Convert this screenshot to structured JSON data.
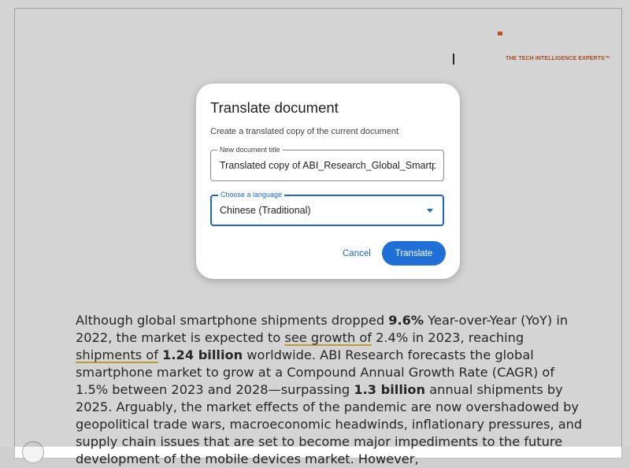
{
  "document": {
    "logo_tagline": "THE TECH INTELLIGENCE EXPERTS™",
    "body": {
      "s1": "Although global smartphone shipments dropped ",
      "b1": "9.6%",
      "s2": " Year-over-Year (YoY) in 2022, the market is expected to ",
      "u1": "see growth of",
      "s3": " 2.4% in 2023, reaching ",
      "u2": "shipments of",
      "s4": " ",
      "b2": "1.24 billion",
      "s5": " worldwide. ABI Research forecasts the global smartphone market to grow at a Compound Annual Growth Rate (CAGR) of 1.5% between 2023 and 2028—surpassing ",
      "b3": "1.3 billion",
      "s6": " annual shipments by 2025. Arguably, the market effects of the pandemic are now overshadowed by geopolitical trade wars, macroeconomic headwinds, inflationary pressures, and supply chain issues that are set to become major impediments to the future development of the mobile devices market. However,"
    }
  },
  "dialog": {
    "title": "Translate document",
    "subtitle": "Create a translated copy of the current document",
    "title_field": {
      "label": "New document title",
      "value": "Translated copy of ABI_Research_Global_Smartphone"
    },
    "language_field": {
      "label": "Choose a language",
      "value": "Chinese (Traditional)"
    },
    "cancel_label": "Cancel",
    "translate_label": "Translate"
  },
  "colors": {
    "accent": "#1f6fd6",
    "logo_orange": "#e0561b",
    "underline": "#e2b634"
  },
  "icons": {
    "dropdown": "caret-down-icon"
  }
}
